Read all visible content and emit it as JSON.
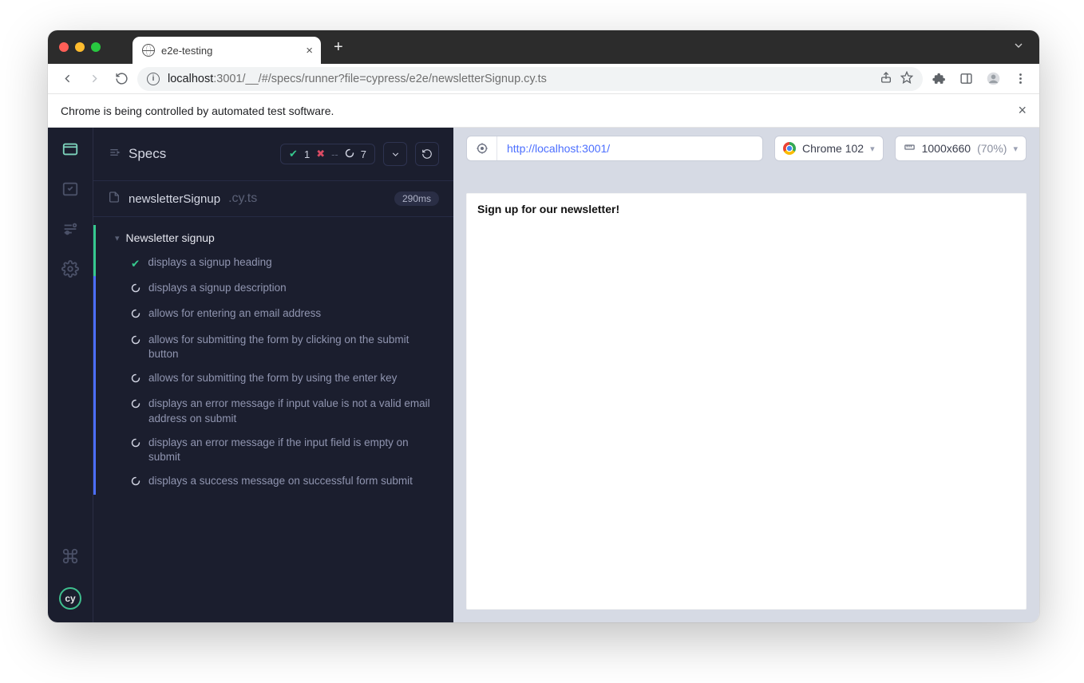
{
  "tab": {
    "title": "e2e-testing"
  },
  "address": {
    "host": "localhost",
    "path": ":3001/__/#/specs/runner?file=cypress/e2e/newsletterSignup.cy.ts"
  },
  "autobanner": {
    "text": "Chrome is being controlled by automated test software."
  },
  "specs_header": {
    "title": "Specs",
    "passed": "1",
    "failed": "--",
    "pending": "7"
  },
  "spec": {
    "name": "newsletterSignup",
    "ext": ".cy.ts",
    "duration": "290ms"
  },
  "suite": {
    "name": "Newsletter signup"
  },
  "tests": [
    {
      "status": "passed",
      "title": "displays a signup heading"
    },
    {
      "status": "running",
      "title": "displays a signup description"
    },
    {
      "status": "running",
      "title": "allows for entering an email address"
    },
    {
      "status": "running",
      "title": "allows for submitting the form by clicking on the submit button"
    },
    {
      "status": "running",
      "title": "allows for submitting the form by using the enter key"
    },
    {
      "status": "running",
      "title": "displays an error message if input value is not a valid email address on submit"
    },
    {
      "status": "running",
      "title": "displays an error message if the input field is empty on submit"
    },
    {
      "status": "running",
      "title": "displays a success message on successful form submit"
    }
  ],
  "aut": {
    "url": "http://localhost:3001/",
    "browser": "Chrome 102",
    "viewport_dims": "1000x660",
    "viewport_scale": "(70%)",
    "heading": "Sign up for our newsletter!"
  },
  "cy_logo": "cy"
}
